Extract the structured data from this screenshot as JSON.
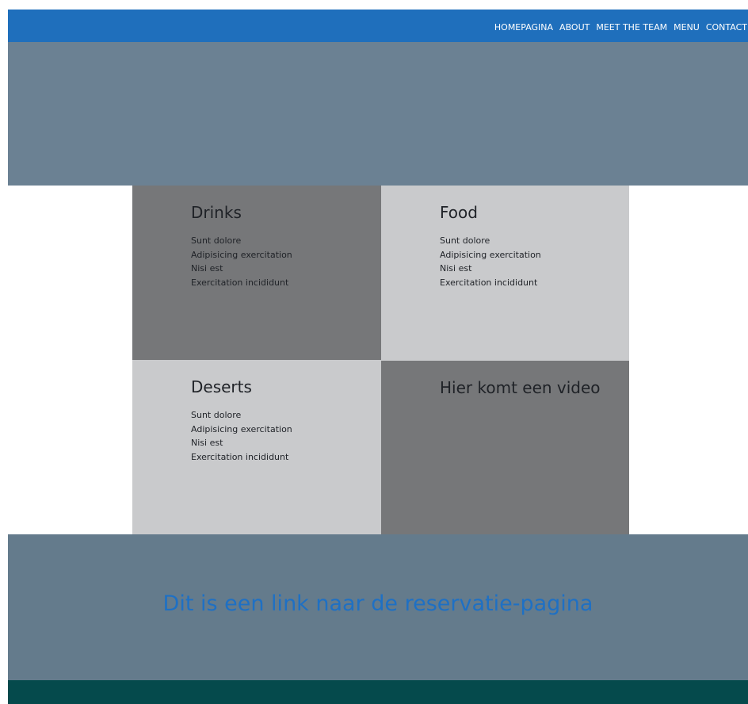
{
  "nav": {
    "items": [
      "HOMEPAGINA",
      "ABOUT",
      "MEET THE TEAM",
      "MENU",
      "CONTACT"
    ]
  },
  "menu": {
    "drinks": {
      "title": "Drinks",
      "items": [
        "Sunt dolore",
        "Adipisicing exercitation",
        "Nisi est",
        "Exercitation incididunt"
      ]
    },
    "food": {
      "title": "Food",
      "items": [
        "Sunt dolore",
        "Adipisicing exercitation",
        "Nisi est",
        "Exercitation incididunt"
      ]
    },
    "deserts": {
      "title": "Deserts",
      "items": [
        "Sunt dolore",
        "Adipisicing exercitation",
        "Nisi est",
        "Exercitation incididunt"
      ]
    },
    "video": {
      "title": "Hier komt een video"
    }
  },
  "reservation": {
    "link_text": "Dit is een link naar de reservatie-pagina"
  },
  "colors": {
    "navbar": "#1f6fbc",
    "hero": "#6b8193",
    "cell_dark": "#767779",
    "cell_light": "#c9cacc",
    "reservation_band": "#647b8c",
    "link": "#1e70c4",
    "footer": "#054a4c"
  }
}
